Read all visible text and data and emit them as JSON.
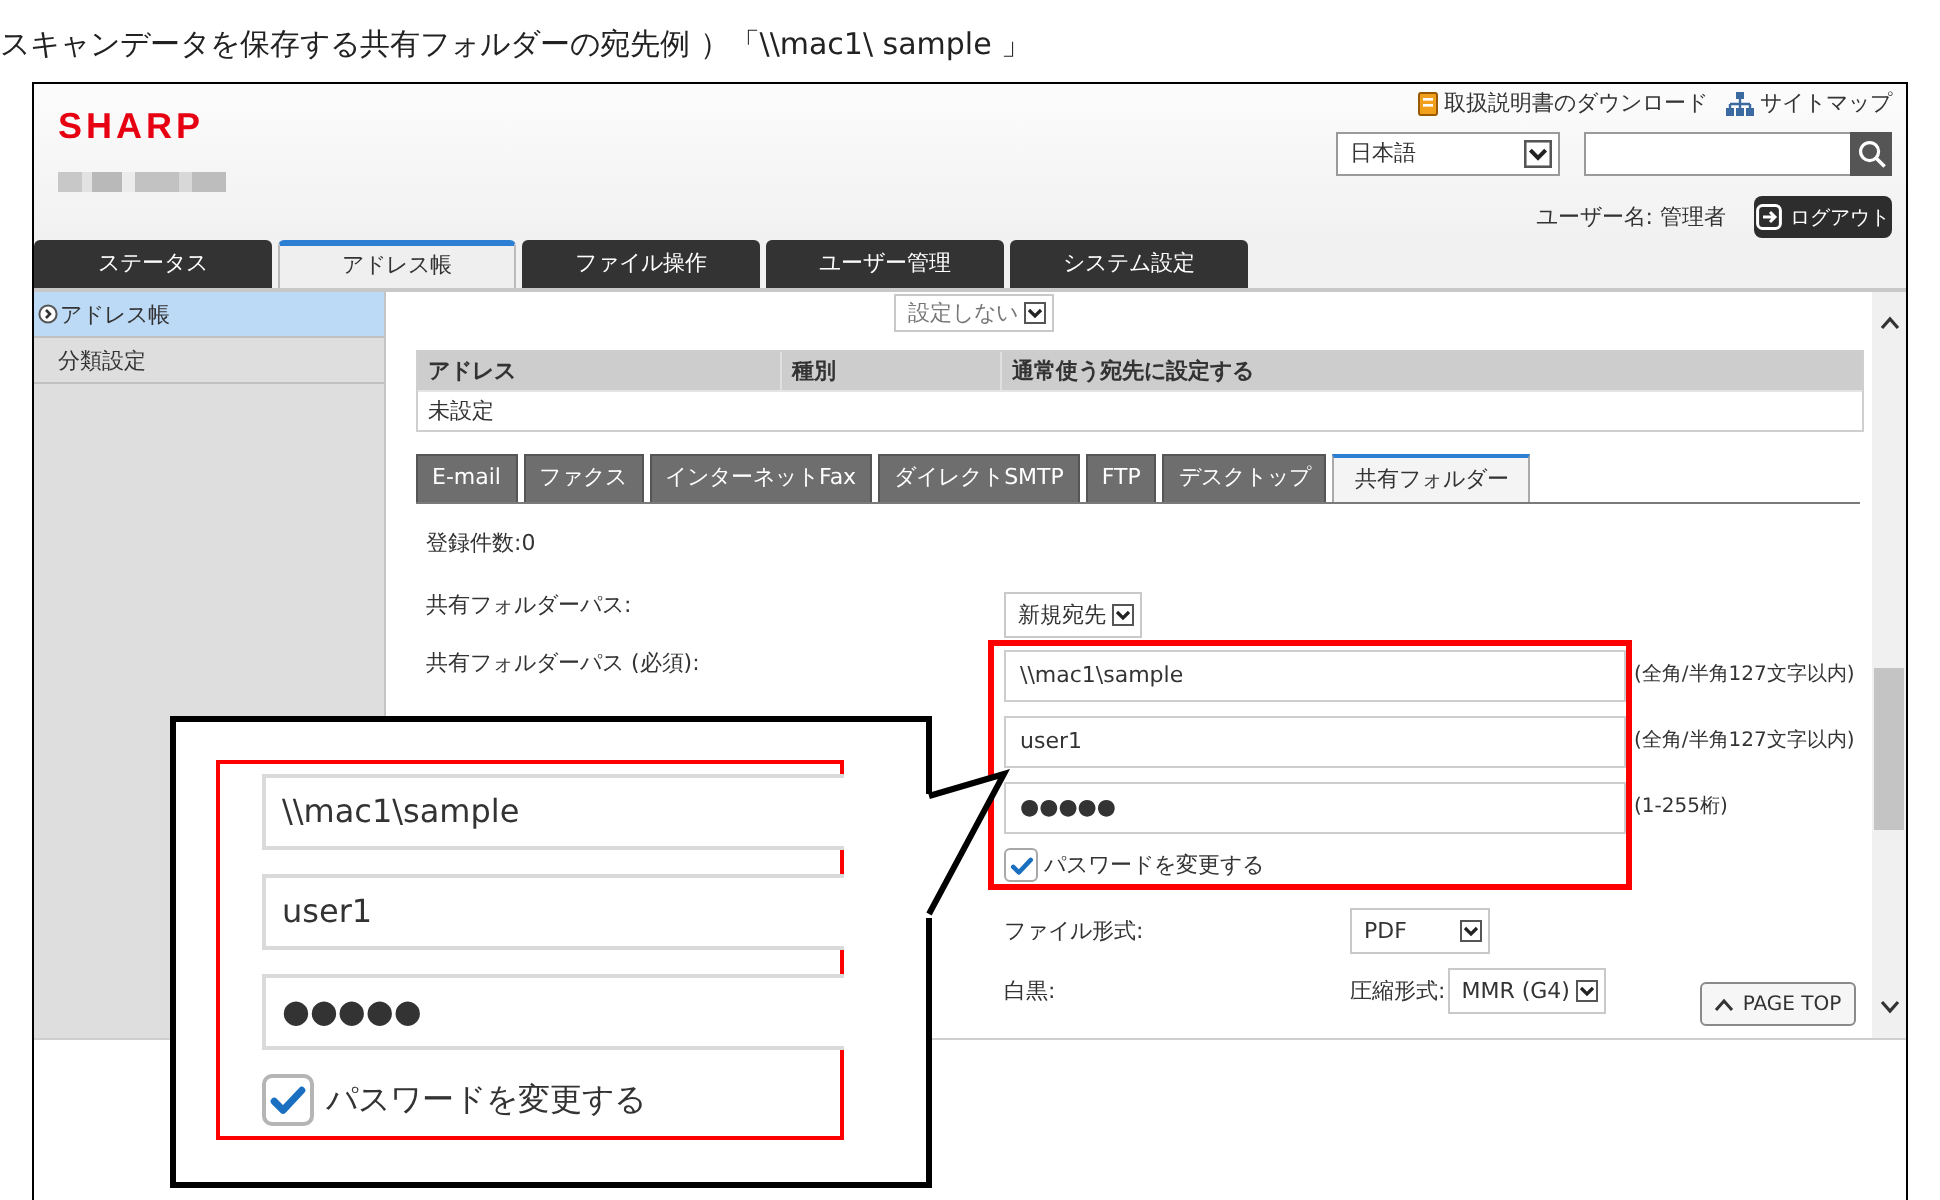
{
  "caption": "スキャンデータを保存する共有フォルダーの宛先例 ）「\\\\mac1\\ sample 」",
  "header": {
    "logo": "SHARP",
    "links": [
      {
        "kind": "manual",
        "label": "取扱説明書のダウンロード"
      },
      {
        "kind": "sitemap",
        "label": "サイトマップ"
      }
    ],
    "language": "日本語",
    "user": "ユーザー名: 管理者",
    "logout": "ログアウト"
  },
  "tabs": [
    {
      "label": "ステータス",
      "selected": false
    },
    {
      "label": "アドレス帳",
      "selected": true
    },
    {
      "label": "ファイル操作",
      "selected": false
    },
    {
      "label": "ユーザー管理",
      "selected": false
    },
    {
      "label": "システム設定",
      "selected": false
    }
  ],
  "sidebar": {
    "items": [
      {
        "label": "アドレス帳",
        "selected": true
      },
      {
        "label": "分類設定",
        "selected": false
      }
    ]
  },
  "content": {
    "top_select": "設定しない",
    "address_table": {
      "columns": [
        "アドレス",
        "種別",
        "通常使う宛先に設定する"
      ],
      "rows": [
        [
          "未設定"
        ]
      ]
    },
    "sub_tabs": [
      {
        "label": "E-mail",
        "selected": false
      },
      {
        "label": "ファクス",
        "selected": false
      },
      {
        "label": "インターネットFax",
        "selected": false
      },
      {
        "label": "ダイレクトSMTP",
        "selected": false
      },
      {
        "label": "FTP",
        "selected": false
      },
      {
        "label": "デスクトップ",
        "selected": false
      },
      {
        "label": "共有フォルダー",
        "selected": true
      }
    ],
    "count": "登録件数:0",
    "form": [
      {
        "kind": "select",
        "label": "共有フォルダーパス:",
        "value": "新規宛先"
      },
      {
        "kind": "text",
        "label": "共有フォルダーパス (必須):",
        "value": "\\\\mac1\\sample",
        "hint": "(全角/半角127文字以内)"
      },
      {
        "kind": "text",
        "value": "user1",
        "hint": "(全角/半角127文字以内)"
      },
      {
        "kind": "text",
        "value": "●●●●●",
        "hint": "(1-255桁)"
      },
      {
        "kind": "checkbox",
        "label": "パスワードを変更する",
        "checked": true
      },
      {
        "kind": "option",
        "label": "ファイル形式:",
        "value": "PDF"
      },
      {
        "kind": "option",
        "label": "白黒:",
        "sublabel": "圧縮形式:",
        "value": "MMR (G4)"
      }
    ],
    "page_top": "PAGE TOP"
  },
  "callout": {
    "fields": [
      "\\\\mac1\\sample",
      "user1",
      "●●●●●"
    ],
    "checkbox": {
      "label": "パスワードを変更する",
      "checked": true
    }
  }
}
